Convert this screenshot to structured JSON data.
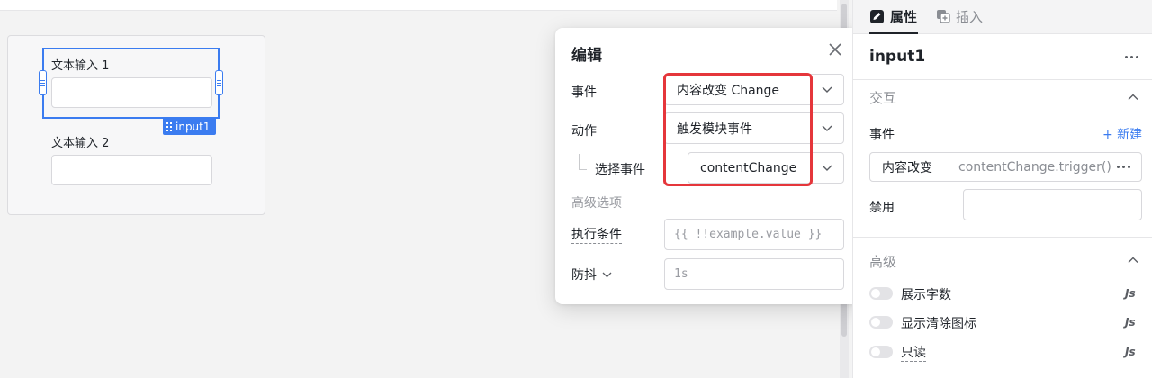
{
  "canvas": {
    "fields": [
      {
        "label": "文本输入 1",
        "value": ""
      },
      {
        "label": "文本输入 2",
        "value": ""
      }
    ],
    "selected_tag": "input1"
  },
  "modal": {
    "title": "编辑",
    "event_label": "事件",
    "event_value": "内容改变 Change",
    "action_label": "动作",
    "action_value": "触发模块事件",
    "select_event_label": "选择事件",
    "select_event_value": "contentChange",
    "advanced_label": "高级选项",
    "condition_label": "执行条件",
    "condition_placeholder": "{{ !!example.value }}",
    "debounce_label": "防抖",
    "debounce_placeholder": "1s"
  },
  "panel": {
    "tabs": [
      {
        "label": "属性",
        "icon": "edit-icon"
      },
      {
        "label": "插入",
        "icon": "plus-square-icon"
      }
    ],
    "component_name": "input1",
    "interaction": {
      "title": "交互",
      "events_label": "事件",
      "new_label": "+ 新建",
      "event_name": "内容改变",
      "event_handler": "contentChange.trigger()",
      "disabled_label": "禁用"
    },
    "advanced": {
      "title": "高级",
      "options": [
        {
          "label": "展示字数",
          "enabled": false
        },
        {
          "label": "显示清除图标",
          "enabled": false
        },
        {
          "label": "只读",
          "enabled": false
        }
      ],
      "js_label": "Js"
    }
  },
  "colors": {
    "accent": "#3b7cf0",
    "highlight": "#e5363b"
  }
}
